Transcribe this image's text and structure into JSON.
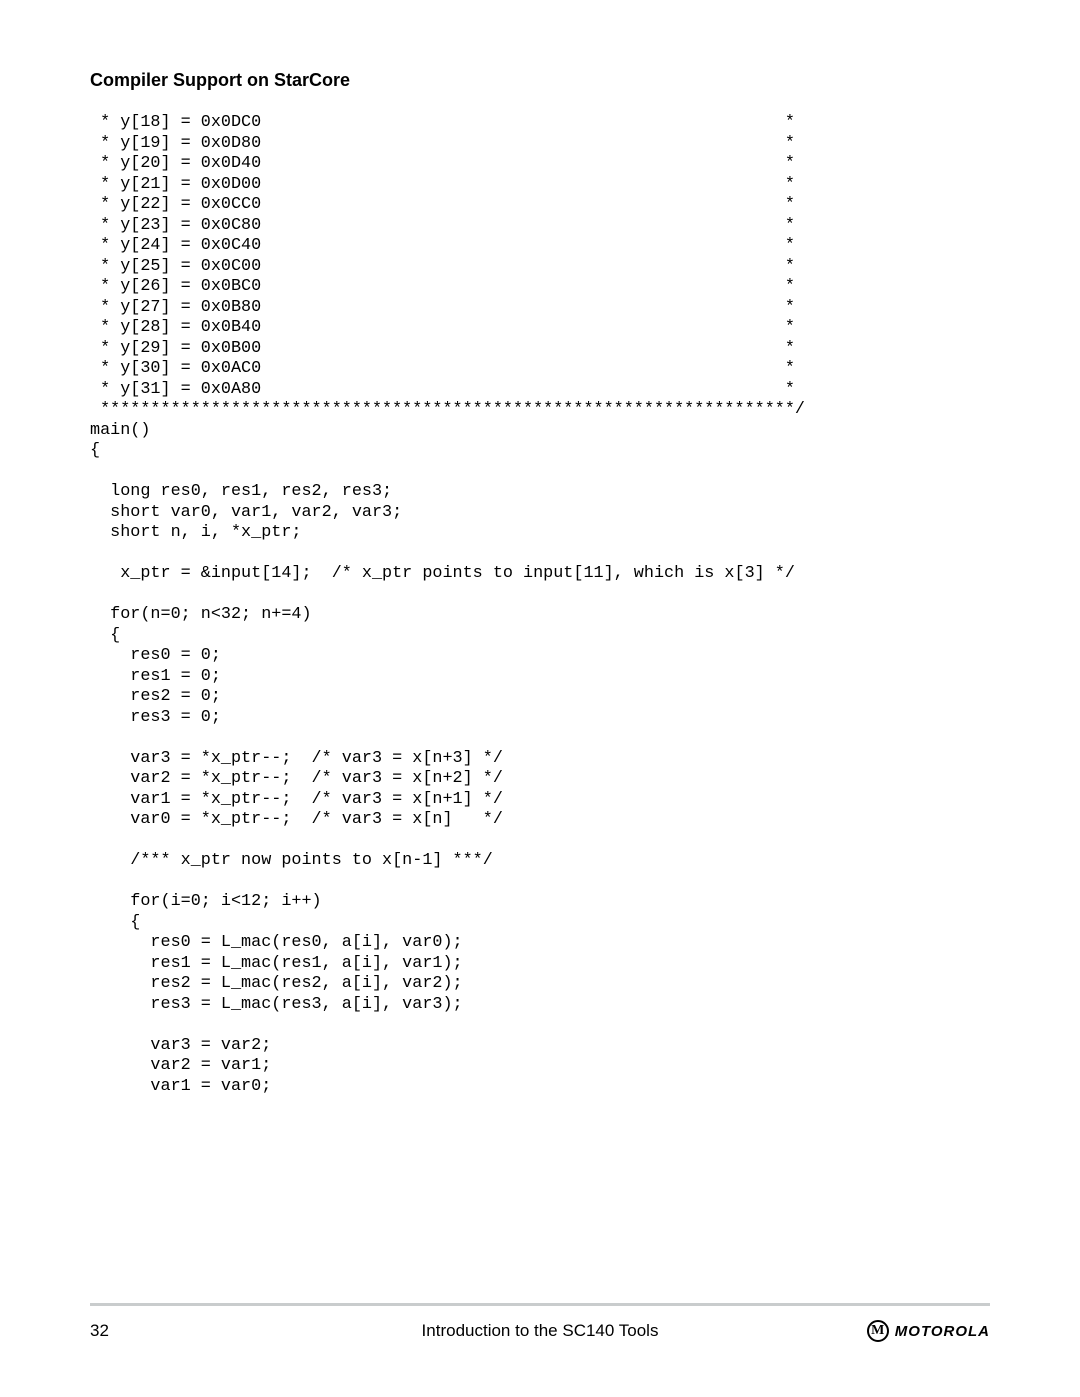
{
  "header": {
    "section_title": "Compiler Support on StarCore"
  },
  "code": {
    "lines": [
      " * y[18] = 0x0DC0                                                    *",
      " * y[19] = 0x0D80                                                    *",
      " * y[20] = 0x0D40                                                    *",
      " * y[21] = 0x0D00                                                    *",
      " * y[22] = 0x0CC0                                                    *",
      " * y[23] = 0x0C80                                                    *",
      " * y[24] = 0x0C40                                                    *",
      " * y[25] = 0x0C00                                                    *",
      " * y[26] = 0x0BC0                                                    *",
      " * y[27] = 0x0B80                                                    *",
      " * y[28] = 0x0B40                                                    *",
      " * y[29] = 0x0B00                                                    *",
      " * y[30] = 0x0AC0                                                    *",
      " * y[31] = 0x0A80                                                    *",
      " *********************************************************************/",
      "main()",
      "{",
      "",
      "  long res0, res1, res2, res3;",
      "  short var0, var1, var2, var3;",
      "  short n, i, *x_ptr;",
      "",
      "   x_ptr = &input[14];  /* x_ptr points to input[11], which is x[3] */",
      "",
      "  for(n=0; n<32; n+=4)",
      "  {",
      "    res0 = 0;",
      "    res1 = 0;",
      "    res2 = 0;",
      "    res3 = 0;",
      "",
      "    var3 = *x_ptr--;  /* var3 = x[n+3] */",
      "    var2 = *x_ptr--;  /* var3 = x[n+2] */",
      "    var1 = *x_ptr--;  /* var3 = x[n+1] */",
      "    var0 = *x_ptr--;  /* var3 = x[n]   */",
      "",
      "    /*** x_ptr now points to x[n-1] ***/",
      "",
      "    for(i=0; i<12; i++)",
      "    {",
      "      res0 = L_mac(res0, a[i], var0);",
      "      res1 = L_mac(res1, a[i], var1);",
      "      res2 = L_mac(res2, a[i], var2);",
      "      res3 = L_mac(res3, a[i], var3);",
      "",
      "      var3 = var2;",
      "      var2 = var1;",
      "      var1 = var0;"
    ]
  },
  "footer": {
    "page_number": "32",
    "center_text": "Introduction to the SC140 Tools",
    "logo_letter": "M",
    "logo_text": "MOTOROLA"
  }
}
